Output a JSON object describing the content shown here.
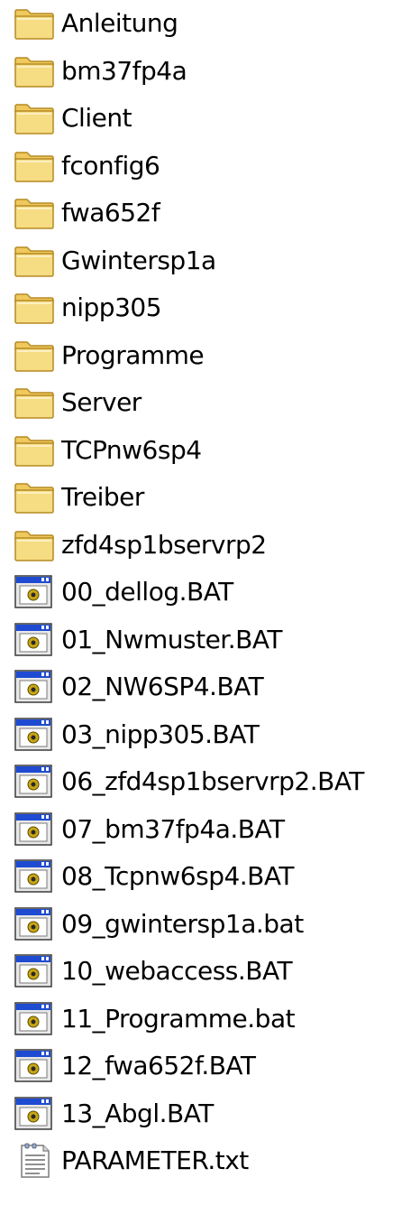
{
  "items": [
    {
      "name": "Anleitung",
      "type": "folder",
      "icon": "folder-icon"
    },
    {
      "name": "bm37fp4a",
      "type": "folder",
      "icon": "folder-icon"
    },
    {
      "name": "Client",
      "type": "folder",
      "icon": "folder-icon"
    },
    {
      "name": "fconfig6",
      "type": "folder",
      "icon": "folder-icon"
    },
    {
      "name": "fwa652f",
      "type": "folder",
      "icon": "folder-icon"
    },
    {
      "name": "Gwintersp1a",
      "type": "folder",
      "icon": "folder-icon"
    },
    {
      "name": "nipp305",
      "type": "folder",
      "icon": "folder-icon"
    },
    {
      "name": "Programme",
      "type": "folder",
      "icon": "folder-icon"
    },
    {
      "name": "Server",
      "type": "folder",
      "icon": "folder-icon"
    },
    {
      "name": "TCPnw6sp4",
      "type": "folder",
      "icon": "folder-icon"
    },
    {
      "name": "Treiber",
      "type": "folder",
      "icon": "folder-icon"
    },
    {
      "name": "zfd4sp1bservrp2",
      "type": "folder",
      "icon": "folder-icon"
    },
    {
      "name": "00_dellog.BAT",
      "type": "batch",
      "icon": "batch-file-icon"
    },
    {
      "name": "01_Nwmuster.BAT",
      "type": "batch",
      "icon": "batch-file-icon"
    },
    {
      "name": "02_NW6SP4.BAT",
      "type": "batch",
      "icon": "batch-file-icon"
    },
    {
      "name": "03_nipp305.BAT",
      "type": "batch",
      "icon": "batch-file-icon"
    },
    {
      "name": "06_zfd4sp1bservrp2.BAT",
      "type": "batch",
      "icon": "batch-file-icon"
    },
    {
      "name": "07_bm37fp4a.BAT",
      "type": "batch",
      "icon": "batch-file-icon"
    },
    {
      "name": "08_Tcpnw6sp4.BAT",
      "type": "batch",
      "icon": "batch-file-icon"
    },
    {
      "name": "09_gwintersp1a.bat",
      "type": "batch",
      "icon": "batch-file-icon"
    },
    {
      "name": "10_webaccess.BAT",
      "type": "batch",
      "icon": "batch-file-icon"
    },
    {
      "name": "11_Programme.bat",
      "type": "batch",
      "icon": "batch-file-icon"
    },
    {
      "name": "12_fwa652f.BAT",
      "type": "batch",
      "icon": "batch-file-icon"
    },
    {
      "name": "13_Abgl.BAT",
      "type": "batch",
      "icon": "batch-file-icon"
    },
    {
      "name": "PARAMETER.txt",
      "type": "text",
      "icon": "text-file-icon"
    }
  ],
  "colors": {
    "folder_fill": "#F6DC83",
    "folder_outline": "#C29A2C",
    "batch_titlebar": "#1E4BD2",
    "batch_gear": "#C8A614",
    "text_color": "#000000"
  }
}
